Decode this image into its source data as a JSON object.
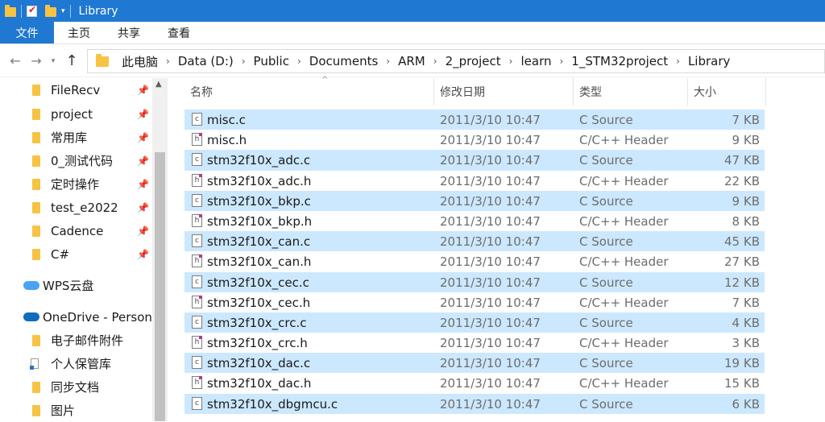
{
  "window": {
    "title": "Library",
    "quick_access_dropdown": "▾"
  },
  "ribbon": {
    "tabs": [
      {
        "label": "文件"
      },
      {
        "label": "主页"
      },
      {
        "label": "共享"
      },
      {
        "label": "查看"
      }
    ]
  },
  "nav": {
    "back": "←",
    "forward": "→",
    "recent": "▾",
    "up": "↑",
    "breadcrumb": [
      "此电脑",
      "Data (D:)",
      "Public",
      "Documents",
      "ARM",
      "2_project",
      "learn",
      "1_STM32project",
      "Library"
    ],
    "separator": "›"
  },
  "sidebar": {
    "pinned": [
      {
        "label": "FileRecv"
      },
      {
        "label": "project"
      },
      {
        "label": "常用库"
      },
      {
        "label": "0_测试代码"
      },
      {
        "label": "定时操作"
      },
      {
        "label": "test_e2022"
      },
      {
        "label": "Cadence"
      },
      {
        "label": "C#"
      }
    ],
    "pin_glyph": "📌",
    "wps": "WPS云盘",
    "onedrive": "OneDrive - Persona",
    "onedrive_children": [
      {
        "label": "电子邮件附件"
      },
      {
        "label": "个人保管库"
      },
      {
        "label": "同步文档"
      },
      {
        "label": "图片"
      }
    ],
    "scroll_up": "▲"
  },
  "columns": {
    "name": "名称",
    "date": "修改日期",
    "type": "类型",
    "size": "大小",
    "sort_caret": "^"
  },
  "files": [
    {
      "name": "misc.c",
      "date": "2011/3/10 10:47",
      "type": "C Source",
      "size": "7 KB",
      "kind": "c",
      "selected": true
    },
    {
      "name": "misc.h",
      "date": "2011/3/10 10:47",
      "type": "C/C++ Header",
      "size": "9 KB",
      "kind": "h",
      "selected": false
    },
    {
      "name": "stm32f10x_adc.c",
      "date": "2011/3/10 10:47",
      "type": "C Source",
      "size": "47 KB",
      "kind": "c",
      "selected": true
    },
    {
      "name": "stm32f10x_adc.h",
      "date": "2011/3/10 10:47",
      "type": "C/C++ Header",
      "size": "22 KB",
      "kind": "h",
      "selected": false
    },
    {
      "name": "stm32f10x_bkp.c",
      "date": "2011/3/10 10:47",
      "type": "C Source",
      "size": "9 KB",
      "kind": "c",
      "selected": true
    },
    {
      "name": "stm32f10x_bkp.h",
      "date": "2011/3/10 10:47",
      "type": "C/C++ Header",
      "size": "8 KB",
      "kind": "h",
      "selected": false
    },
    {
      "name": "stm32f10x_can.c",
      "date": "2011/3/10 10:47",
      "type": "C Source",
      "size": "45 KB",
      "kind": "c",
      "selected": true
    },
    {
      "name": "stm32f10x_can.h",
      "date": "2011/3/10 10:47",
      "type": "C/C++ Header",
      "size": "27 KB",
      "kind": "h",
      "selected": false
    },
    {
      "name": "stm32f10x_cec.c",
      "date": "2011/3/10 10:47",
      "type": "C Source",
      "size": "12 KB",
      "kind": "c",
      "selected": true
    },
    {
      "name": "stm32f10x_cec.h",
      "date": "2011/3/10 10:47",
      "type": "C/C++ Header",
      "size": "7 KB",
      "kind": "h",
      "selected": false
    },
    {
      "name": "stm32f10x_crc.c",
      "date": "2011/3/10 10:47",
      "type": "C Source",
      "size": "4 KB",
      "kind": "c",
      "selected": true
    },
    {
      "name": "stm32f10x_crc.h",
      "date": "2011/3/10 10:47",
      "type": "C/C++ Header",
      "size": "3 KB",
      "kind": "h",
      "selected": false
    },
    {
      "name": "stm32f10x_dac.c",
      "date": "2011/3/10 10:47",
      "type": "C Source",
      "size": "19 KB",
      "kind": "c",
      "selected": true
    },
    {
      "name": "stm32f10x_dac.h",
      "date": "2011/3/10 10:47",
      "type": "C/C++ Header",
      "size": "15 KB",
      "kind": "h",
      "selected": false
    },
    {
      "name": "stm32f10x_dbgmcu.c",
      "date": "2011/3/10 10:47",
      "type": "C Source",
      "size": "6 KB",
      "kind": "c",
      "selected": true
    }
  ],
  "colors": {
    "accent": "#1f78d1",
    "selection": "#cce8ff",
    "folder": "#f6c343"
  }
}
